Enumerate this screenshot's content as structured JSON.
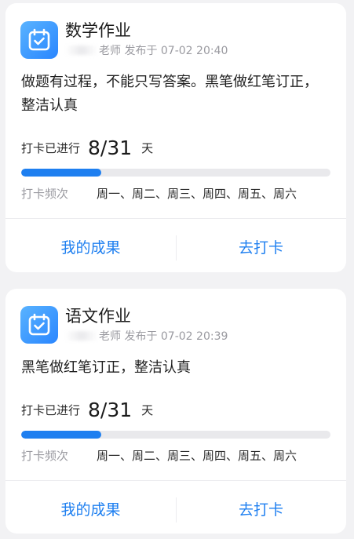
{
  "assignments": [
    {
      "title": "数学作业",
      "teacher_suffix": "老师",
      "published": "发布于 07-02 20:40",
      "description": "做题有过程，不能只写答案。黑笔做红笔订正，整洁认真",
      "progress_label": "打卡已进行",
      "progress_count": "8/31",
      "progress_unit": "天",
      "progress_fraction": 0.258,
      "frequency_label": "打卡频次",
      "frequency_days": "周一、周二、周三、周四、周五、周六",
      "results_button": "我的成果",
      "checkin_button": "去打卡"
    },
    {
      "title": "语文作业",
      "teacher_suffix": "老师",
      "published": "发布于 07-02 20:39",
      "description": "黑笔做红笔订正，整洁认真",
      "progress_label": "打卡已进行",
      "progress_count": "8/31",
      "progress_unit": "天",
      "progress_fraction": 0.258,
      "frequency_label": "打卡频次",
      "frequency_days": "周一、周二、周三、周四、周五、周六",
      "results_button": "我的成果",
      "checkin_button": "去打卡"
    }
  ],
  "icons": {
    "app": "calendar-check-icon"
  },
  "colors": {
    "accent": "#1e7ff0",
    "icon_gradient_start": "#59b3ff",
    "icon_gradient_end": "#2a86ff",
    "track": "#e9e9ec",
    "background": "#f2f2f4"
  }
}
